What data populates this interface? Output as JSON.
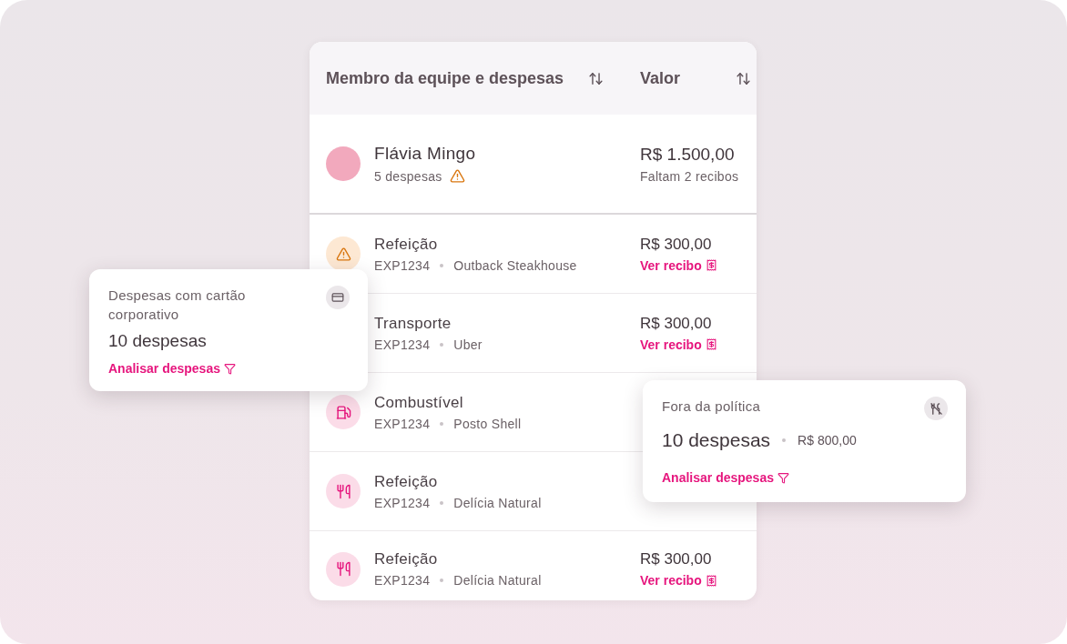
{
  "table": {
    "columns": [
      {
        "label": "Membro da equipe e despesas",
        "sortable": true
      },
      {
        "label": "Valor",
        "sortable": true
      }
    ],
    "member": {
      "name": "Flávia Mingo",
      "subtitle": "5 despesas",
      "warning": true,
      "amount": "R$ 1.500,00",
      "note": "Faltam 2 recibos"
    },
    "expenses": [
      {
        "kind": "warning",
        "title": "Refeição",
        "code": "EXP1234",
        "merchant": "Outback Steakhouse",
        "amount": "R$ 300,00",
        "link": "Ver recibo"
      },
      {
        "title": "Transporte",
        "code": "EXP1234",
        "merchant": "Uber",
        "amount": "R$ 300,00",
        "link": "Ver recibo"
      },
      {
        "kind": "fuel",
        "title": "Combustível",
        "code": "EXP1234",
        "merchant": "Posto Shell"
      },
      {
        "kind": "meal",
        "title": "Refeição",
        "code": "EXP1234",
        "merchant": "Delícia Natural"
      },
      {
        "kind": "meal",
        "title": "Refeição",
        "code": "EXP1234",
        "merchant": "Delícia Natural",
        "amount": "R$ 300,00",
        "link": "Ver recibo"
      }
    ]
  },
  "cards": [
    {
      "kind": "card",
      "title": "Despesas com cartão corporativo",
      "count": "10 despesas",
      "link": "Analisar despesas"
    },
    {
      "kind": "policy",
      "title": "Fora da política",
      "count": "10 despesas",
      "total": "R$ 800,00",
      "link": "Analisar despesas"
    }
  ]
}
